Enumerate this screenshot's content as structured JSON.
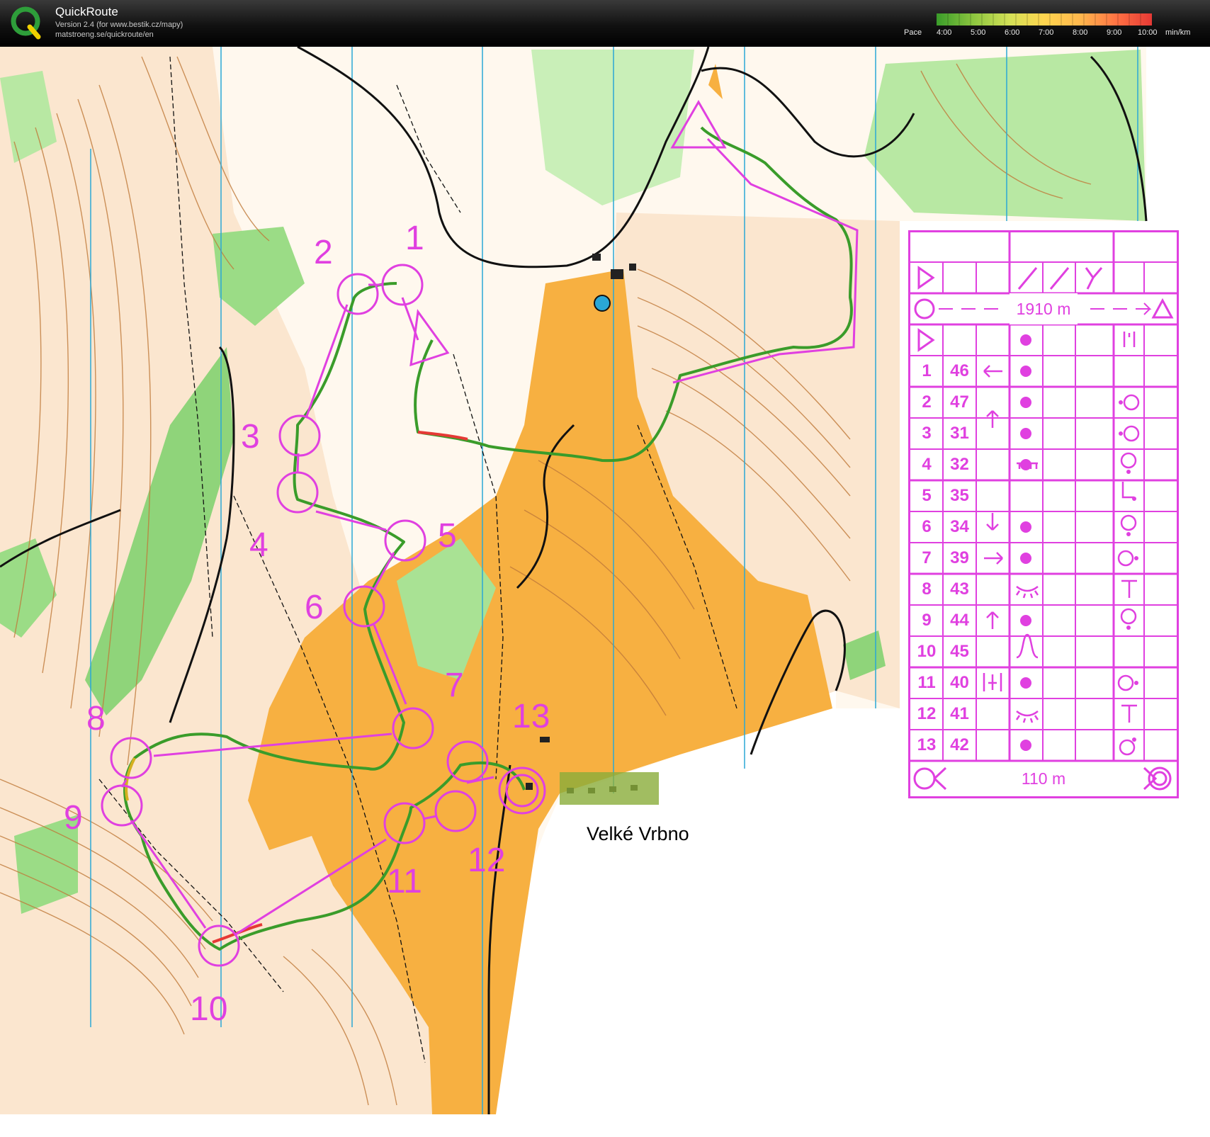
{
  "app": {
    "title": "QuickRoute",
    "version": "Version 2.4  (for www.bestik.cz/mapy)",
    "url": "matstroeng.se/quickroute/en"
  },
  "pace_legend": {
    "label": "Pace",
    "ticks": [
      "4:00",
      "5:00",
      "6:00",
      "7:00",
      "8:00",
      "9:00",
      "10:00"
    ],
    "unit": "min/km",
    "colors": [
      "#3a9c2a",
      "#8cc63f",
      "#d4e157",
      "#ffd54f",
      "#ffb74d",
      "#ff7043",
      "#e53935"
    ]
  },
  "map": {
    "place_name": "Velké Vrbno",
    "course_color": "#e040e0",
    "control_labels": [
      "1",
      "2",
      "3",
      "4",
      "5",
      "6",
      "7",
      "8",
      "9",
      "10",
      "11",
      "12",
      "13"
    ]
  },
  "control_descriptions": {
    "course_length": "1910 m",
    "finish_length": "110 m",
    "rows": [
      {
        "num": "1",
        "code": "46"
      },
      {
        "num": "2",
        "code": "47"
      },
      {
        "num": "3",
        "code": "31"
      },
      {
        "num": "4",
        "code": "32"
      },
      {
        "num": "5",
        "code": "35"
      },
      {
        "num": "6",
        "code": "34"
      },
      {
        "num": "7",
        "code": "39"
      },
      {
        "num": "8",
        "code": "43"
      },
      {
        "num": "9",
        "code": "44"
      },
      {
        "num": "10",
        "code": "45"
      },
      {
        "num": "11",
        "code": "40"
      },
      {
        "num": "12",
        "code": "41"
      },
      {
        "num": "13",
        "code": "42"
      }
    ]
  }
}
